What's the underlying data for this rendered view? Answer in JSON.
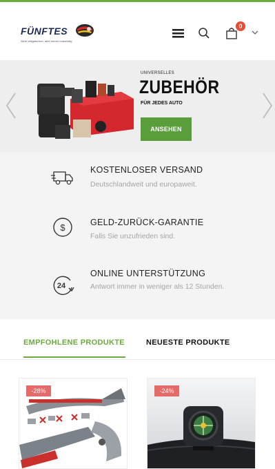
{
  "header": {
    "brand": "FÜNFTES",
    "tagline": "Nicht obligatorisch, aber immer notwendig",
    "cart_count": "0"
  },
  "slider": {
    "kicker": "UNIVERSELLES",
    "title": "ZUBEHÖR",
    "subtitle": "FÜR JEDES AUTO",
    "button_label": "ANSEHEN"
  },
  "features": [
    {
      "icon": "truck-icon",
      "title": "KOSTENLOSER VERSAND",
      "text": "Deutschlandweit und europaweit."
    },
    {
      "icon": "dollar-circle-icon",
      "title": "GELD-ZURÜCK-GARANTIE",
      "text": "Falls Sie unzufrieden sind."
    },
    {
      "icon": "24h-support-icon",
      "title": "ONLINE UNTERSTÜTZUNG",
      "text": "Antwort immer in weniger als 12 Stunden."
    }
  ],
  "tabs": {
    "featured": "EMPFOHLENE PRODUKTE",
    "newest": "NEUESTE PRODUKTE"
  },
  "products": [
    {
      "badge": "-28%"
    },
    {
      "badge": "-24%"
    }
  ],
  "colors": {
    "accent": "#6cab3f",
    "button": "#5a9e3c",
    "badge": "#e56a6a",
    "cart_badge": "#e94b35"
  }
}
